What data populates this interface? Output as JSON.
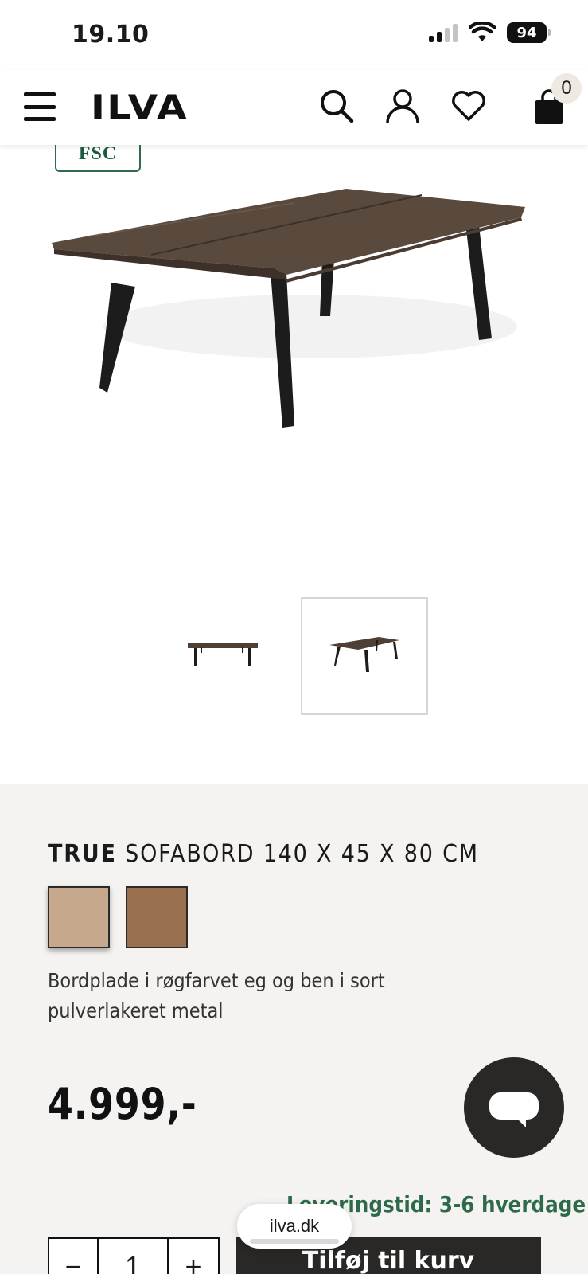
{
  "status_bar": {
    "time": "19.10",
    "battery": "94"
  },
  "header": {
    "logo": "ILVA",
    "cart_count": "0",
    "icons": [
      "menu-icon",
      "search-icon",
      "account-icon",
      "heart-icon",
      "bag-icon"
    ]
  },
  "gallery": {
    "badge": "FSC",
    "thumbnails": [
      {
        "alt": "front view",
        "selected": false
      },
      {
        "alt": "angled view",
        "selected": true
      }
    ]
  },
  "product": {
    "brand": "TRUE",
    "name": "SOFABORD 140 X 45 X 80 CM",
    "swatches": [
      {
        "color": "#c6a98c",
        "selected": true
      },
      {
        "color": "#9a7050",
        "selected": false
      }
    ],
    "description": "Bordplade i røgfarvet eg og ben i sort pulverlakeret metal",
    "price": "4.999,-",
    "delivery": "Leveringstid: 3-6 hverdage",
    "quantity": "1",
    "qty_minus": "−",
    "qty_plus": "+",
    "add_to_cart": "Tilføj til kurv"
  },
  "browser": {
    "url": "ilva.dk"
  },
  "colors": {
    "accent_green": "#2d6a4a",
    "dark": "#2a2826",
    "panel_bg": "#f4f3f1"
  }
}
